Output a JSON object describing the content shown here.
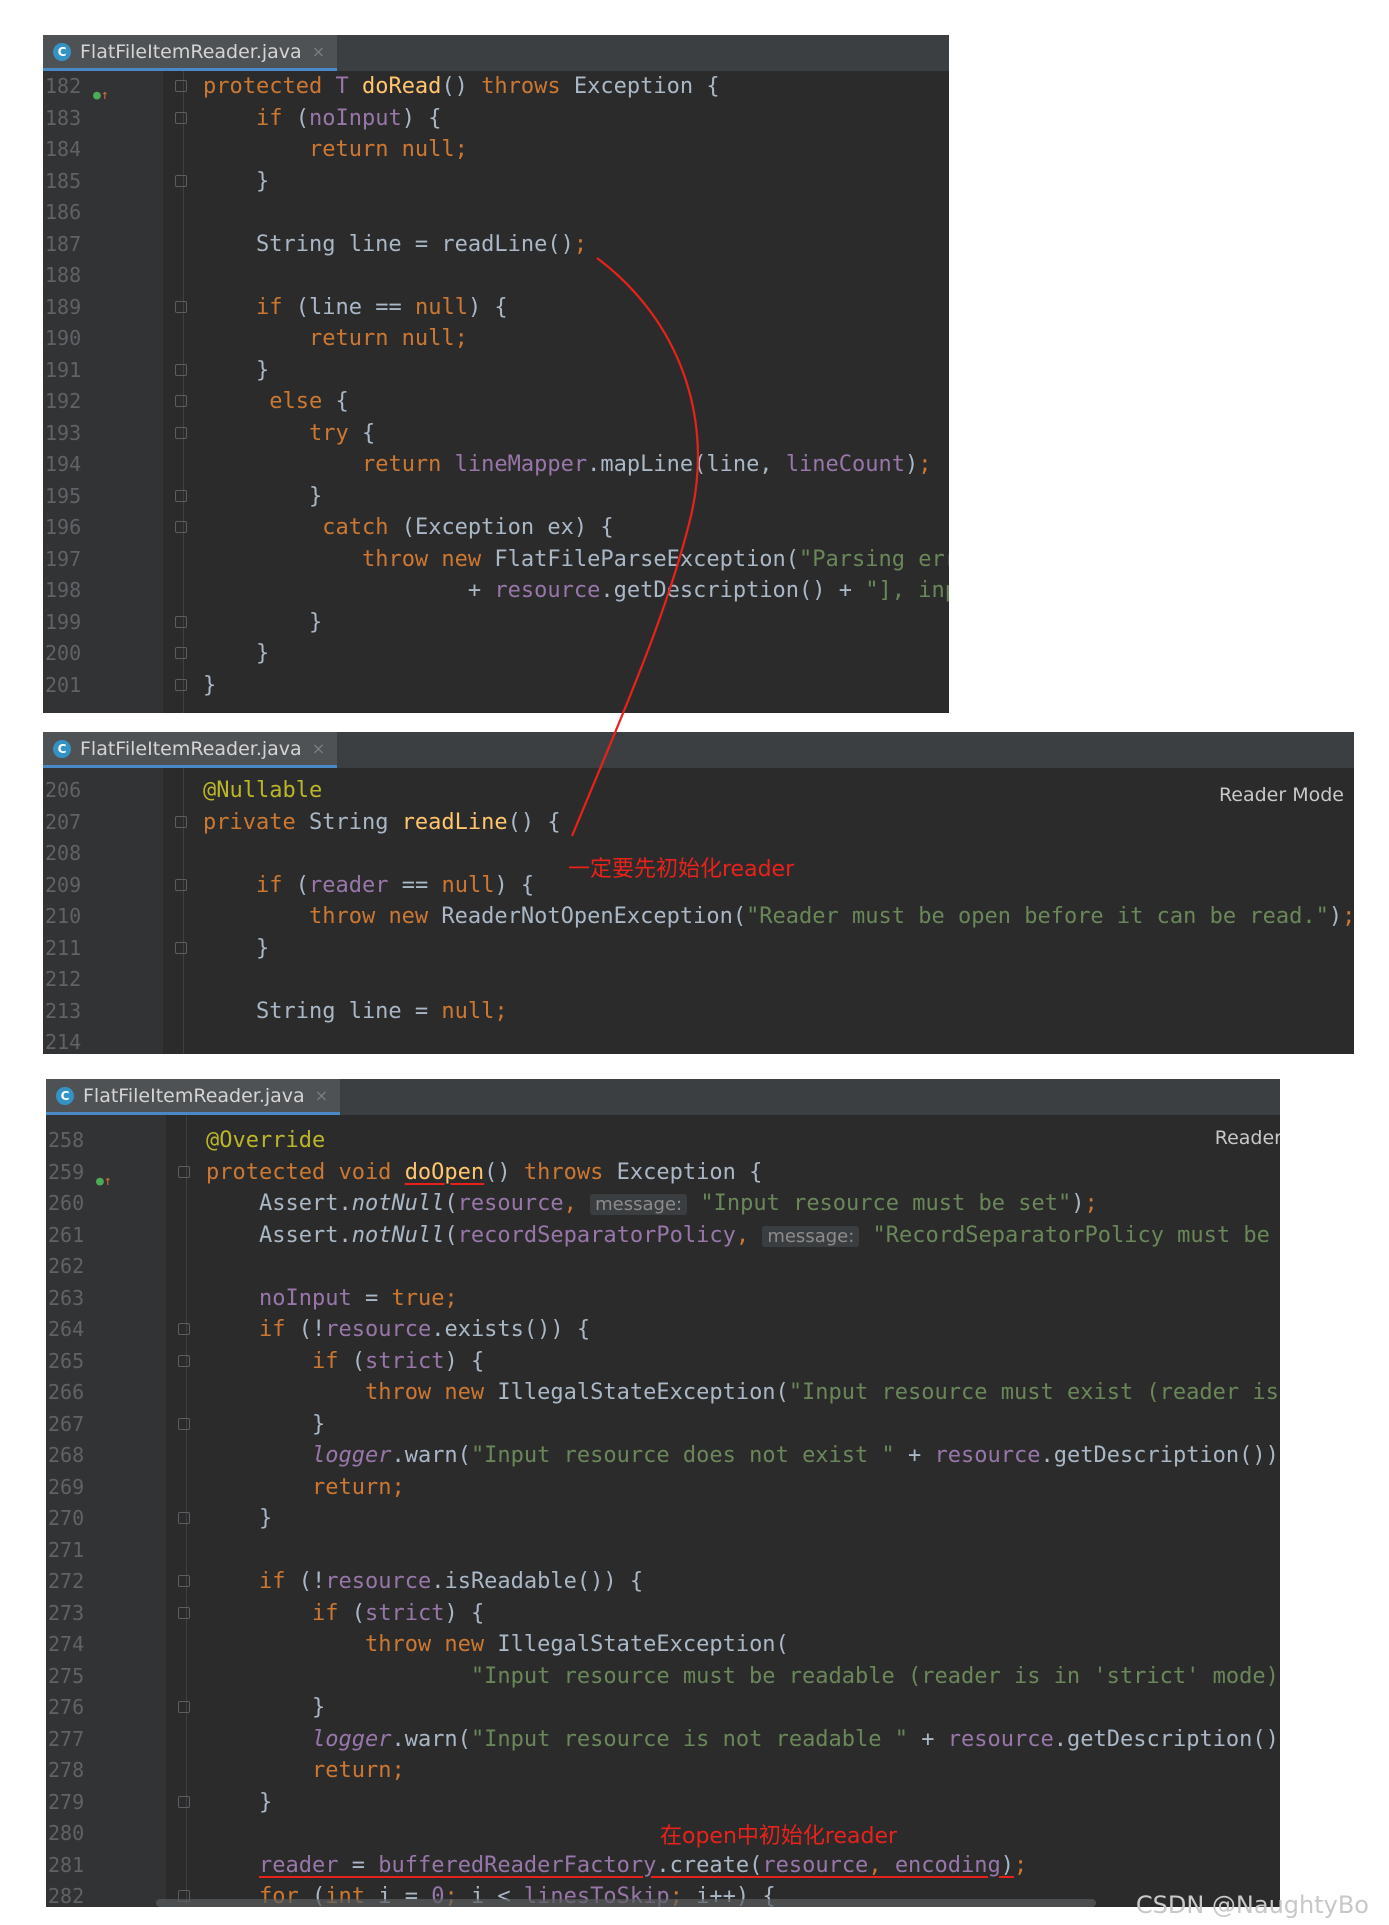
{
  "panels": [
    {
      "tab": {
        "icon": "C",
        "filename": "FlatFileItemReader.java",
        "close": "×"
      },
      "lines": [
        {
          "n": "182",
          "code": [
            [
              "k",
              "protected "
            ],
            [
              "f",
              "T "
            ],
            [
              "m",
              "doRead"
            ],
            [
              "",
              "() "
            ],
            [
              "k",
              "throws "
            ],
            [
              "",
              "Exception {"
            ]
          ]
        },
        {
          "n": "183",
          "code": [
            [
              "",
              "    "
            ],
            [
              "k",
              "if "
            ],
            [
              "",
              "("
            ],
            [
              "f",
              "noInput"
            ],
            [
              "",
              ") {"
            ]
          ]
        },
        {
          "n": "184",
          "code": [
            [
              "",
              "        "
            ],
            [
              "k",
              "return null;"
            ]
          ]
        },
        {
          "n": "185",
          "code": [
            [
              "",
              "    }"
            ]
          ]
        },
        {
          "n": "186",
          "code": []
        },
        {
          "n": "187",
          "code": [
            [
              "",
              "    String line = readLine()"
            ],
            [
              "k",
              ";"
            ]
          ]
        },
        {
          "n": "188",
          "code": []
        },
        {
          "n": "189",
          "code": [
            [
              "",
              "    "
            ],
            [
              "k",
              "if "
            ],
            [
              "",
              "(line == "
            ],
            [
              "k",
              "null"
            ],
            [
              "",
              ") {"
            ]
          ]
        },
        {
          "n": "190",
          "code": [
            [
              "",
              "        "
            ],
            [
              "k",
              "return null;"
            ]
          ]
        },
        {
          "n": "191",
          "code": [
            [
              "",
              "    }"
            ]
          ]
        },
        {
          "n": "192",
          "code": [
            [
              "",
              "     "
            ],
            [
              "k",
              "else "
            ],
            [
              "",
              "{"
            ]
          ]
        },
        {
          "n": "193",
          "code": [
            [
              "",
              "        "
            ],
            [
              "k",
              "try "
            ],
            [
              "",
              "{"
            ]
          ]
        },
        {
          "n": "194",
          "code": [
            [
              "",
              "            "
            ],
            [
              "k",
              "return "
            ],
            [
              "f",
              "lineMapper"
            ],
            [
              "",
              ".mapLine(line, "
            ],
            [
              "f",
              "lineCount"
            ],
            [
              "",
              ")"
            ],
            [
              "k",
              ";"
            ]
          ]
        },
        {
          "n": "195",
          "code": [
            [
              "",
              "        }"
            ]
          ]
        },
        {
          "n": "196",
          "code": [
            [
              "",
              "         "
            ],
            [
              "k",
              "catch "
            ],
            [
              "",
              "(Exception ex) {"
            ]
          ]
        },
        {
          "n": "197",
          "code": [
            [
              "",
              "            "
            ],
            [
              "k",
              "throw new "
            ],
            [
              "",
              "FlatFileParseException("
            ],
            [
              "s",
              "\"Parsing err"
            ]
          ]
        },
        {
          "n": "198",
          "code": [
            [
              "",
              "                    + "
            ],
            [
              "f",
              "resource"
            ],
            [
              "",
              ".getDescription() + "
            ],
            [
              "s",
              "\"], inp"
            ]
          ]
        },
        {
          "n": "199",
          "code": [
            [
              "",
              "        }"
            ]
          ]
        },
        {
          "n": "200",
          "code": [
            [
              "",
              "    }"
            ]
          ]
        },
        {
          "n": "201",
          "code": [
            [
              "",
              "}"
            ]
          ]
        }
      ]
    },
    {
      "tab": {
        "icon": "C",
        "filename": "FlatFileItemReader.java",
        "close": "×"
      },
      "reader_mode": "Reader Mode",
      "lines": [
        {
          "n": "206",
          "code": [
            [
              "a",
              "@Nullable"
            ]
          ]
        },
        {
          "n": "207",
          "code": [
            [
              "k",
              "private "
            ],
            [
              "",
              "String "
            ],
            [
              "m",
              "readLine"
            ],
            [
              "",
              "() {"
            ]
          ]
        },
        {
          "n": "208",
          "code": []
        },
        {
          "n": "209",
          "code": [
            [
              "",
              "    "
            ],
            [
              "k",
              "if "
            ],
            [
              "",
              "("
            ],
            [
              "f",
              "reader"
            ],
            [
              "",
              ""
            ],
            [
              "",
              " == "
            ],
            [
              "k",
              "null"
            ],
            [
              "",
              ") {"
            ]
          ]
        },
        {
          "n": "210",
          "code": [
            [
              "",
              "        "
            ],
            [
              "k",
              "throw new "
            ],
            [
              "",
              "ReaderNotOpenException("
            ],
            [
              "s",
              "\"Reader must be open before it can be read.\""
            ],
            [
              "",
              ")"
            ],
            [
              "k",
              ";"
            ]
          ]
        },
        {
          "n": "211",
          "code": [
            [
              "",
              "    }"
            ]
          ]
        },
        {
          "n": "212",
          "code": []
        },
        {
          "n": "213",
          "code": [
            [
              "",
              "    String line = "
            ],
            [
              "k",
              "null;"
            ]
          ]
        },
        {
          "n": "214",
          "code": []
        }
      ]
    },
    {
      "tab": {
        "icon": "C",
        "filename": "FlatFileItemReader.java",
        "close": "×"
      },
      "reader_mode": "Reader",
      "lines": [
        {
          "n": "258",
          "code": [
            [
              "a",
              "@Override"
            ]
          ]
        },
        {
          "n": "259",
          "code": [
            [
              "k",
              "protected void "
            ],
            [
              "mu",
              "doOpen"
            ],
            [
              "",
              "() "
            ],
            [
              "k",
              "throws "
            ],
            [
              "",
              "Exception {"
            ]
          ]
        },
        {
          "n": "260",
          "code": [
            [
              "",
              "    Assert."
            ],
            [
              "i",
              "notNull"
            ],
            [
              "",
              "("
            ],
            [
              "f",
              "resource"
            ],
            [
              "k",
              ", "
            ],
            [
              "h",
              "message:"
            ],
            [
              "s",
              " \"Input resource must be set\""
            ],
            [
              "",
              ")"
            ],
            [
              "k",
              ";"
            ]
          ]
        },
        {
          "n": "261",
          "code": [
            [
              "",
              "    Assert."
            ],
            [
              "i",
              "notNull"
            ],
            [
              "",
              "("
            ],
            [
              "f",
              "recordSeparatorPolicy"
            ],
            [
              "k",
              ", "
            ],
            [
              "h",
              "message:"
            ],
            [
              "s",
              " \"RecordSeparatorPolicy must be s"
            ]
          ]
        },
        {
          "n": "262",
          "code": []
        },
        {
          "n": "263",
          "code": [
            [
              "",
              "    "
            ],
            [
              "f",
              "noInput "
            ],
            [
              "",
              "= "
            ],
            [
              "k",
              "true;"
            ]
          ]
        },
        {
          "n": "264",
          "code": [
            [
              "",
              "    "
            ],
            [
              "k",
              "if "
            ],
            [
              "",
              "(!"
            ],
            [
              "f",
              "resource"
            ],
            [
              "",
              ".exists()) {"
            ]
          ]
        },
        {
          "n": "265",
          "code": [
            [
              "",
              "        "
            ],
            [
              "k",
              "if "
            ],
            [
              "",
              "("
            ],
            [
              "f",
              "strict"
            ],
            [
              "",
              ") {"
            ]
          ]
        },
        {
          "n": "266",
          "code": [
            [
              "",
              "            "
            ],
            [
              "k",
              "throw new "
            ],
            [
              "",
              "IllegalStateException("
            ],
            [
              "s",
              "\"Input resource must exist (reader is "
            ]
          ]
        },
        {
          "n": "267",
          "code": [
            [
              "",
              "        }"
            ]
          ]
        },
        {
          "n": "268",
          "code": [
            [
              "",
              "        "
            ],
            [
              "fi",
              "logger"
            ],
            [
              "",
              ".warn("
            ],
            [
              "s",
              "\"Input resource does not exist \""
            ],
            [
              "",
              " + "
            ],
            [
              "f",
              "resource"
            ],
            [
              "",
              ".getDescription())"
            ],
            [
              "k",
              ";"
            ]
          ]
        },
        {
          "n": "269",
          "code": [
            [
              "",
              "        "
            ],
            [
              "k",
              "return;"
            ]
          ]
        },
        {
          "n": "270",
          "code": [
            [
              "",
              "    }"
            ]
          ]
        },
        {
          "n": "271",
          "code": []
        },
        {
          "n": "272",
          "code": [
            [
              "",
              "    "
            ],
            [
              "k",
              "if "
            ],
            [
              "",
              "(!"
            ],
            [
              "f",
              "resource"
            ],
            [
              "",
              ".isReadable()) {"
            ]
          ]
        },
        {
          "n": "273",
          "code": [
            [
              "",
              "        "
            ],
            [
              "k",
              "if "
            ],
            [
              "",
              "("
            ],
            [
              "f",
              "strict"
            ],
            [
              "",
              ") {"
            ]
          ]
        },
        {
          "n": "274",
          "code": [
            [
              "",
              "            "
            ],
            [
              "k",
              "throw new "
            ],
            [
              "",
              "IllegalStateException("
            ]
          ]
        },
        {
          "n": "275",
          "code": [
            [
              "",
              "                    "
            ],
            [
              "s",
              "\"Input resource must be readable (reader is in 'strict' mode):"
            ]
          ]
        },
        {
          "n": "276",
          "code": [
            [
              "",
              "        }"
            ]
          ]
        },
        {
          "n": "277",
          "code": [
            [
              "",
              "        "
            ],
            [
              "fi",
              "logger"
            ],
            [
              "",
              ".warn("
            ],
            [
              "s",
              "\"Input resource is not readable \""
            ],
            [
              "",
              " + "
            ],
            [
              "f",
              "resource"
            ],
            [
              "",
              ".getDescription())"
            ]
          ]
        },
        {
          "n": "278",
          "code": [
            [
              "",
              "        "
            ],
            [
              "k",
              "return;"
            ]
          ]
        },
        {
          "n": "279",
          "code": [
            [
              "",
              "    }"
            ]
          ]
        },
        {
          "n": "280",
          "code": []
        },
        {
          "n": "281",
          "code": [
            [
              "",
              "    "
            ],
            [
              "fu",
              "reader"
            ],
            [
              "u",
              " = "
            ],
            [
              "fu",
              "bufferedReaderFactory"
            ],
            [
              "u",
              ".create("
            ],
            [
              "fu",
              "resource"
            ],
            [
              "ku",
              ", "
            ],
            [
              "fu",
              "encoding"
            ],
            [
              "u",
              ")"
            ],
            [
              "k",
              ";"
            ]
          ]
        },
        {
          "n": "282",
          "code": [
            [
              "",
              "    "
            ],
            [
              "k",
              "for "
            ],
            [
              "",
              "("
            ],
            [
              "k",
              "int "
            ],
            [
              "",
              "i = "
            ],
            [
              "f",
              "0"
            ],
            [
              "k",
              "; "
            ],
            [
              "",
              "i < "
            ],
            [
              "f",
              "linesToSkip"
            ],
            [
              "k",
              "; "
            ],
            [
              "",
              "i++) {"
            ]
          ]
        }
      ]
    }
  ],
  "annotations": {
    "note1": "一定要先初始化reader",
    "note2": "在open中初始化reader"
  },
  "watermark": "CSDN @NaughtyBo",
  "colors": {
    "annotation": "#e8221b",
    "keyword": "#cc7832",
    "method": "#ffc66d",
    "field": "#9876aa",
    "string": "#6a8759",
    "annotation_code": "#bbb529"
  }
}
